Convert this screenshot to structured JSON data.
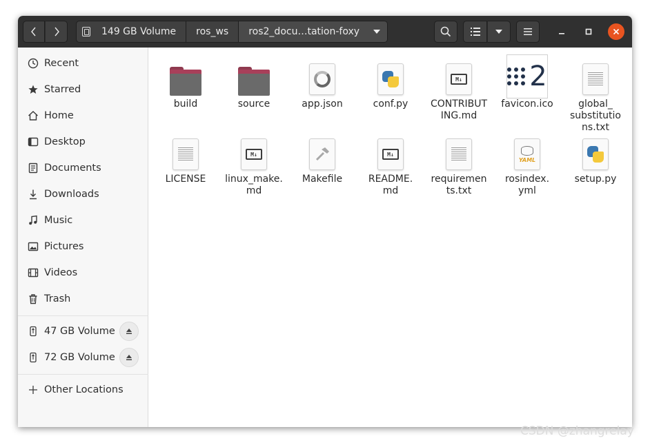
{
  "header": {
    "breadcrumbs": [
      "149 GB Volume",
      "ros_ws",
      "ros2_docu…tation-foxy"
    ],
    "icons": {
      "back": "chevron-left-icon",
      "forward": "chevron-right-icon",
      "search": "search-icon",
      "view": "list-view-icon",
      "menu": "hamburger-menu-icon"
    }
  },
  "sidebar": {
    "places": [
      {
        "label": "Recent",
        "icon": "clock-icon"
      },
      {
        "label": "Starred",
        "icon": "star-icon"
      },
      {
        "label": "Home",
        "icon": "home-icon"
      },
      {
        "label": "Desktop",
        "icon": "desktop-icon"
      },
      {
        "label": "Documents",
        "icon": "documents-icon"
      },
      {
        "label": "Downloads",
        "icon": "downloads-icon"
      },
      {
        "label": "Music",
        "icon": "music-icon"
      },
      {
        "label": "Pictures",
        "icon": "pictures-icon"
      },
      {
        "label": "Videos",
        "icon": "videos-icon"
      },
      {
        "label": "Trash",
        "icon": "trash-icon"
      }
    ],
    "volumes": [
      {
        "label": "47 GB Volume",
        "icon": "usb-drive-icon"
      },
      {
        "label": "72 GB Volume",
        "icon": "usb-drive-icon"
      }
    ],
    "other": {
      "label": "Other Locations",
      "icon": "plus-icon"
    }
  },
  "files": [
    {
      "name": "build",
      "type": "folder"
    },
    {
      "name": "source",
      "type": "folder"
    },
    {
      "name": "app.json",
      "type": "json"
    },
    {
      "name": "conf.py",
      "type": "python"
    },
    {
      "name": "CONTRIBUTING.md",
      "type": "markdown"
    },
    {
      "name": "favicon.ico",
      "type": "image"
    },
    {
      "name": "global_substitutions.txt",
      "type": "text"
    },
    {
      "name": "LICENSE",
      "type": "text"
    },
    {
      "name": "linux_make.md",
      "type": "markdown"
    },
    {
      "name": "Makefile",
      "type": "makefile"
    },
    {
      "name": "README.md",
      "type": "markdown"
    },
    {
      "name": "requirements.txt",
      "type": "text"
    },
    {
      "name": "rosindex.yml",
      "type": "yaml"
    },
    {
      "name": "setup.py",
      "type": "python"
    }
  ],
  "file_labels": {
    "global_substitutions": [
      "global_",
      "substitutio",
      "ns.txt"
    ],
    "contributing": [
      "CONTRIBUT",
      "ING.md"
    ],
    "linux_make": [
      "linux_make.",
      "md"
    ],
    "readme": [
      "README.",
      "md"
    ],
    "requirements": [
      "requiremen",
      "ts.txt"
    ],
    "rosindex": [
      "rosindex.",
      "yml"
    ]
  },
  "badges": {
    "markdown": "M↓",
    "yaml": "YAML"
  },
  "watermark": "CSDN @zhangrelay"
}
